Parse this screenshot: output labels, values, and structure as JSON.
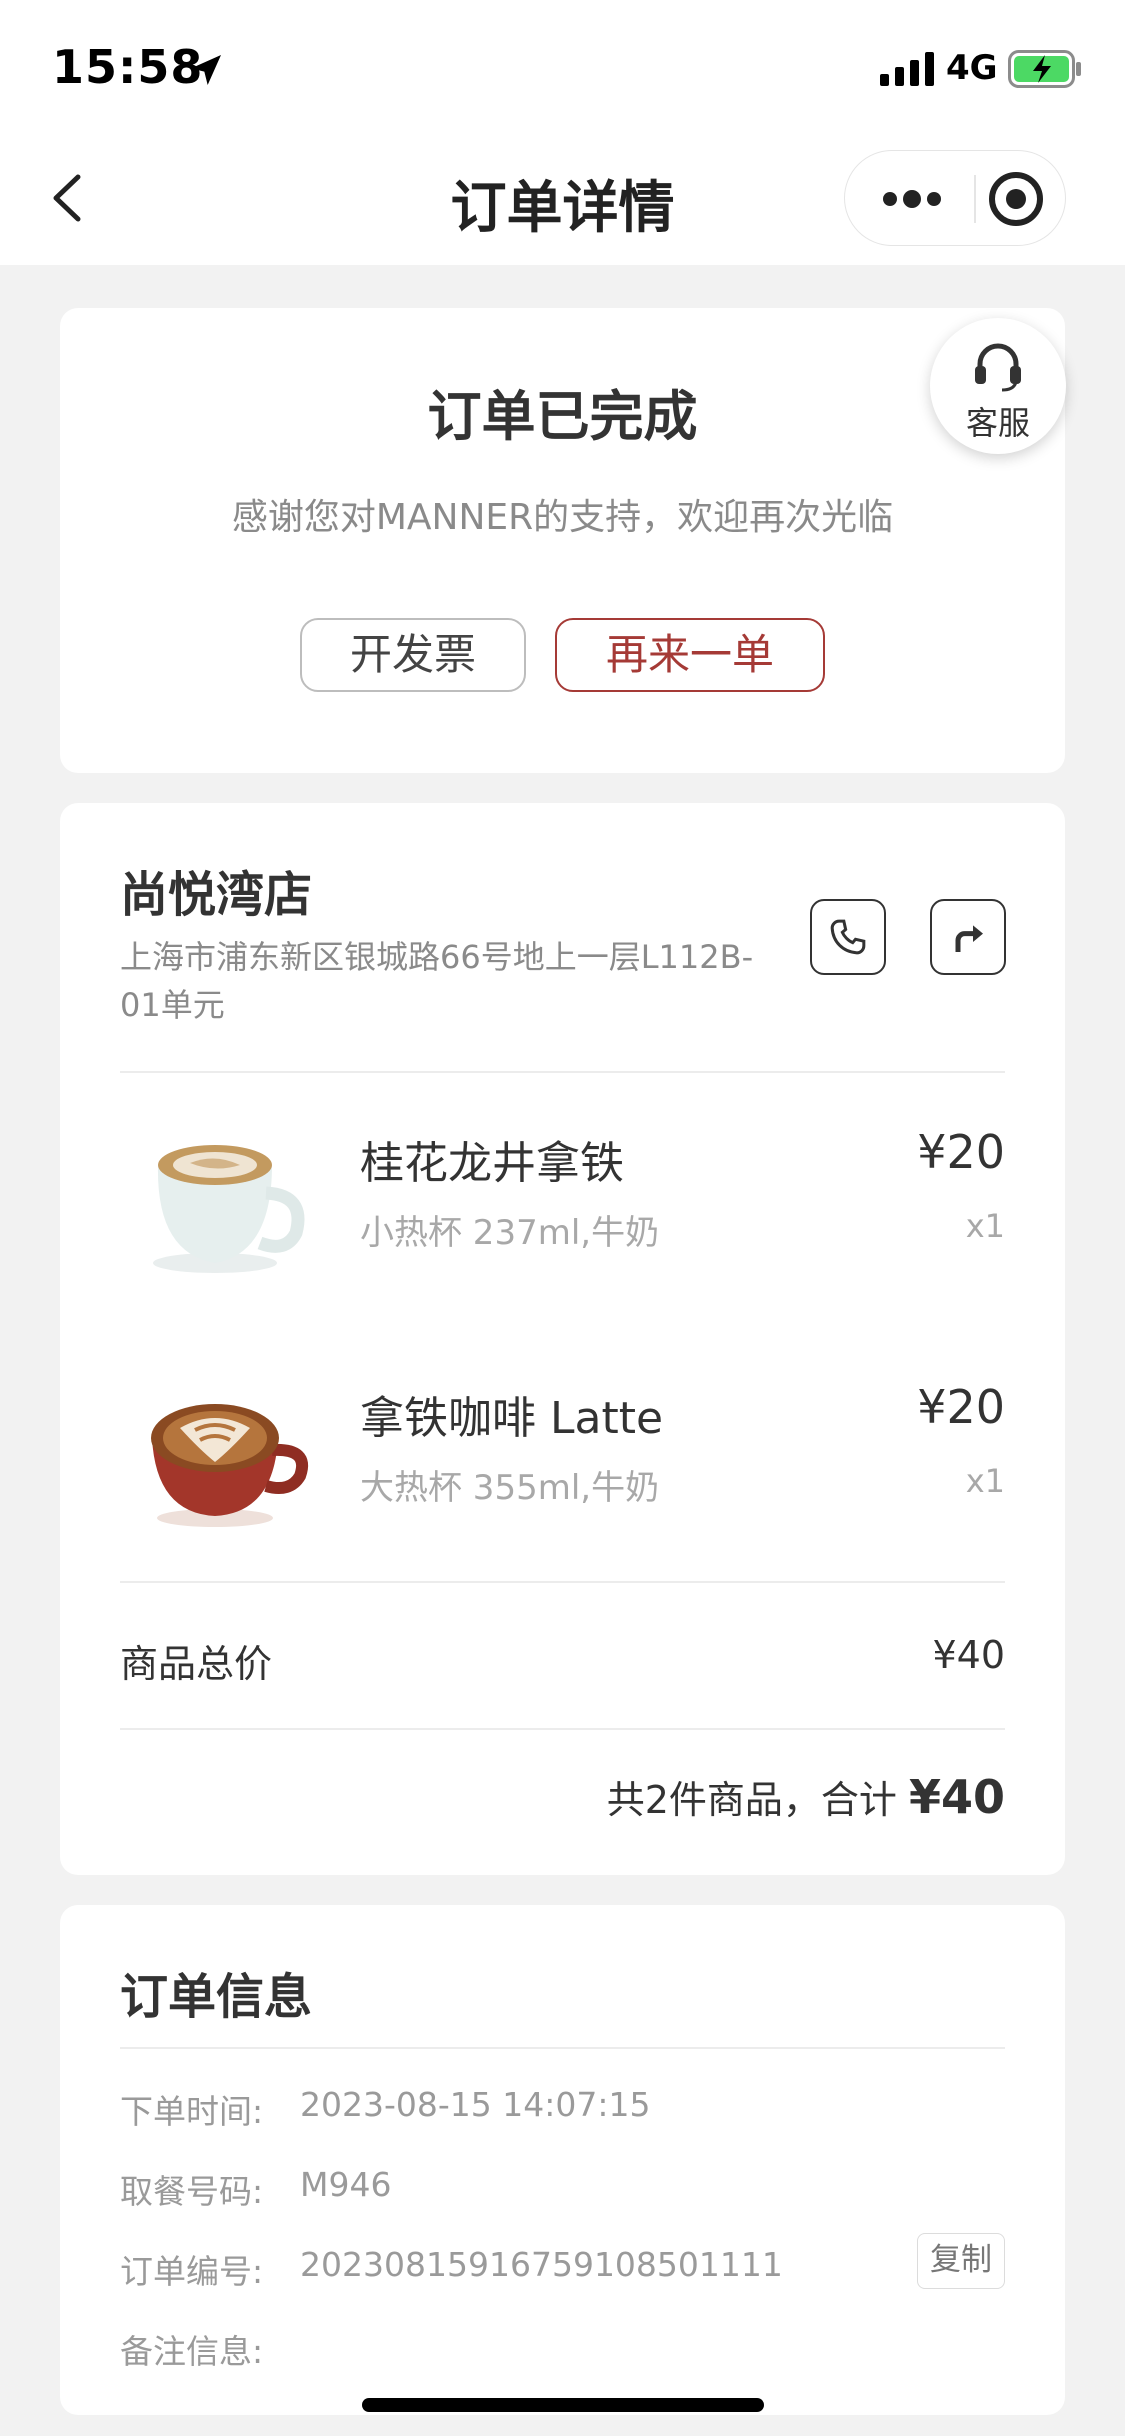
{
  "status_bar": {
    "time": "15:58",
    "network": "4G"
  },
  "nav": {
    "title": "订单详情"
  },
  "status_card": {
    "title": "订单已完成",
    "subtitle": "感谢您对MANNER的支持，欢迎再次光临",
    "invoice_button": "开发票",
    "reorder_button": "再来一单",
    "service_label": "客服"
  },
  "store": {
    "name": "尚悦湾店",
    "address": "上海市浦东新区银城路66号地上一层L112B-01单元"
  },
  "products": [
    {
      "name": "桂花龙井拿铁",
      "spec": "小热杯 237ml,牛奶",
      "price": "¥20",
      "qty": "x1"
    },
    {
      "name": "拿铁咖啡 Latte",
      "spec": "大热杯 355ml,牛奶",
      "price": "¥20",
      "qty": "x1"
    }
  ],
  "summary": {
    "subtotal_label": "商品总价",
    "subtotal_value": "¥40",
    "total_prefix": "共2件商品，合计",
    "total_amount": "¥40"
  },
  "order_info": {
    "title": "订单信息",
    "rows": [
      {
        "label": "下单时间:",
        "value": "2023-08-15 14:07:15"
      },
      {
        "label": "取餐号码:",
        "value": "M946"
      },
      {
        "label": "订单编号:",
        "value": "20230815916759108501111"
      },
      {
        "label": "备注信息:",
        "value": ""
      }
    ],
    "copy_button": "复制"
  },
  "colors": {
    "accent": "#a53a36",
    "background": "#f2f2f2",
    "battery": "#4cd964"
  }
}
